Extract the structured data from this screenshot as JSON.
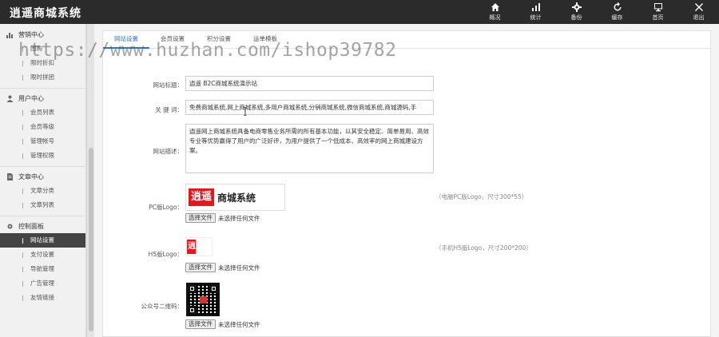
{
  "app": {
    "title": "逍遥商城系统"
  },
  "topnav": [
    {
      "label": "概况",
      "icon": "home-icon"
    },
    {
      "label": "统计",
      "icon": "bar-chart-icon"
    },
    {
      "label": "备份",
      "icon": "gear-icon"
    },
    {
      "label": "缓存",
      "icon": "refresh-icon"
    },
    {
      "label": "首页",
      "icon": "monitor-icon"
    },
    {
      "label": "退出",
      "icon": "close-icon"
    }
  ],
  "sidebar": {
    "groups": [
      {
        "title": "营销中心",
        "icon": "chart-icon",
        "items": [
          "团购",
          "限时折扣",
          "限时拼团"
        ]
      },
      {
        "title": "用户中心",
        "icon": "user-icon",
        "items": [
          "会员列表",
          "会员等级",
          "管理帐号",
          "管理权限"
        ]
      },
      {
        "title": "文章中心",
        "icon": "document-icon",
        "items": [
          "文章分类",
          "文章列表"
        ]
      },
      {
        "title": "控制面板",
        "icon": "settings-icon",
        "items": [
          "网站设置",
          "支付设置",
          "导航管理",
          "广告管理",
          "友情链接"
        ]
      }
    ],
    "active_item": "网站设置"
  },
  "tabs": [
    "网站设置",
    "会员设置",
    "积分设置",
    "运单模板"
  ],
  "form": {
    "site_title_label": "网站标题：",
    "site_title_value": "逍遥 B2C商城系统演示站",
    "keywords_label": "关 键 词：",
    "keywords_value": "免费商城系统,网上商城系统,多用户商城系统,分销商城系统,微信商城系统,商城源码,手",
    "desc_label": "网站描述：",
    "desc_value": "逍遥网上商城系统具备电商零售业务所需的所有基本功能，以其安全稳定、简单易用、高效专业等优势赢得了用户的广泛好评，为用户提供了一个低成本、高效率的网上商城建设方案。",
    "pc_logo_label": "PC版Logo：",
    "pc_logo_hint": "（电脑PC版Logo，尺寸300*55）",
    "h5_logo_label": "H5版Logo：",
    "h5_logo_hint": "（手机H5版Logo，尺寸200*200）",
    "qr_label": "公众号二维码：",
    "file_button": "选择文件",
    "file_none": "未选择任何文件",
    "logo_red_text": "逍遥",
    "logo_text": "商城系统"
  },
  "watermark": "https://www.huzhan.com/ishop39782",
  "colors": {
    "topbar": "#2b2b2b",
    "accent": "#1e7bd1",
    "logo_red": "#e8161a",
    "active_menu": "#444444"
  }
}
